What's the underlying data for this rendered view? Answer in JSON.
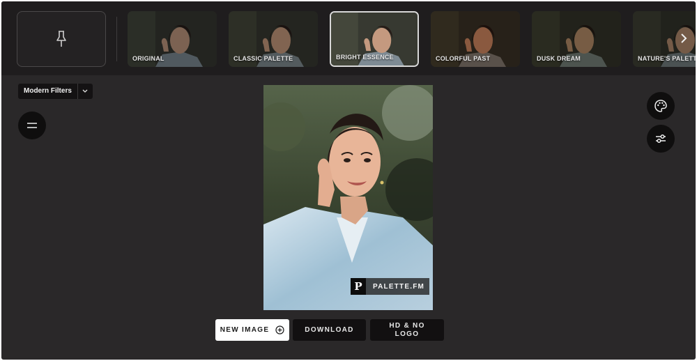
{
  "filters": {
    "scroll_icon": "chevron-right-icon",
    "pin_icon": "pin-icon",
    "tiles": [
      {
        "label": "ORIGINAL",
        "selected": false,
        "tint": "#8a8a8a"
      },
      {
        "label": "CLASSIC PALETTE",
        "selected": false,
        "tint": "#9a9186"
      },
      {
        "label": "BRIGHT ESSENCE",
        "selected": true,
        "tint": "#a89f92"
      },
      {
        "label": "COLORFUL PAST",
        "selected": false,
        "tint": "#b5652f"
      },
      {
        "label": "DUSK DREAM",
        "selected": false,
        "tint": "#7a7448"
      },
      {
        "label": "NATURE'S PALETTE",
        "selected": false,
        "tint": "#6f6a58"
      }
    ]
  },
  "toolbar": {
    "filter_set_label": "Modern Filters",
    "menu_icon": "menu-icon",
    "palette_icon": "palette-icon",
    "adjust_icon": "sliders-icon"
  },
  "photo": {
    "watermark_logo": "P",
    "watermark_text": "PALETTE.FM"
  },
  "actions": {
    "new_image": "NEW IMAGE",
    "download": "DOWNLOAD",
    "hd_no_logo": "HD & NO LOGO"
  }
}
